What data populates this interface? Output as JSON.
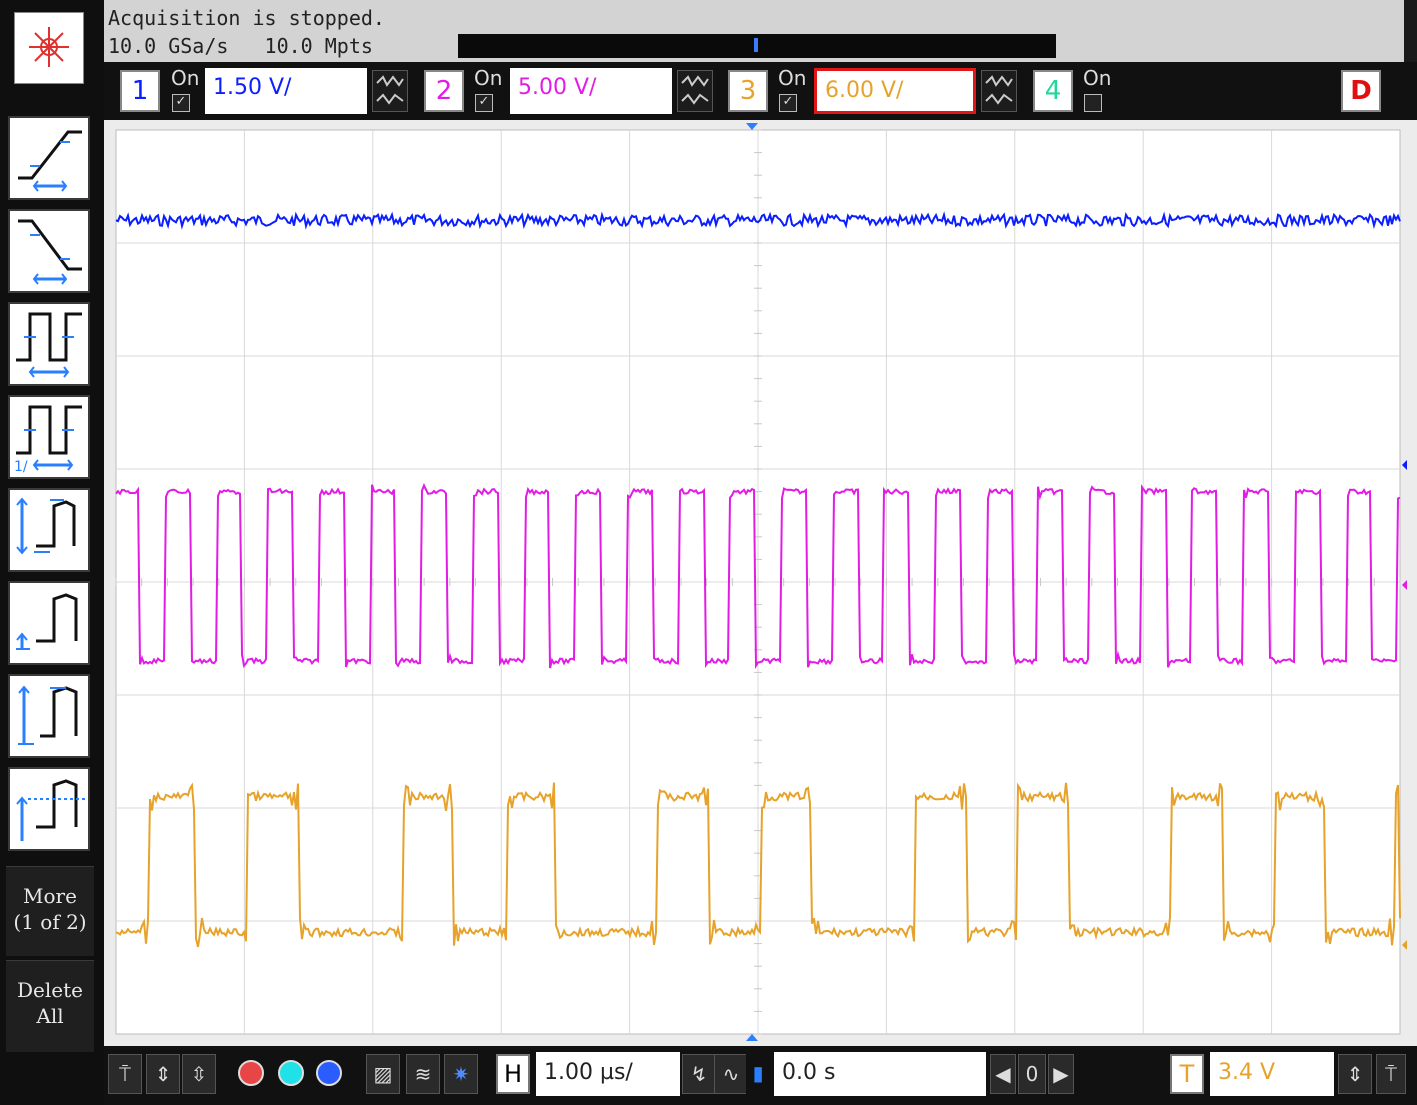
{
  "status": {
    "acquisition": "Acquisition is stopped.",
    "sample_rate": "10.0 GSa/s",
    "memory_depth": "10.0 Mpts"
  },
  "channels": [
    {
      "number": "1",
      "on_label": "On",
      "enabled": true,
      "scale": "1.50 V/",
      "color": "#0a1eff"
    },
    {
      "number": "2",
      "on_label": "On",
      "enabled": true,
      "scale": "5.00 V/",
      "color": "#e21ce6"
    },
    {
      "number": "3",
      "on_label": "On",
      "enabled": true,
      "scale": "6.00 V/",
      "color": "#e6a22a",
      "selected": true,
      "selected_color": "#e11616"
    },
    {
      "number": "4",
      "on_label": "On",
      "enabled": false,
      "color": "#22d79a"
    }
  ],
  "digital_label": "D",
  "sidebar": {
    "more_label_1": "More",
    "more_label_2": "(1 of 2)",
    "delete_label_1": "Delete",
    "delete_label_2": "All",
    "icons": [
      "rise-time-icon",
      "fall-time-icon",
      "period-icon",
      "frequency-icon",
      "peak-to-peak-icon",
      "maximum-icon",
      "amplitude-icon",
      "top-icon"
    ]
  },
  "timebase": {
    "horizontal_label": "H",
    "scale": "1.00 µs/",
    "delay": "0.0 s",
    "zoom_value": "0"
  },
  "trigger": {
    "label": "T",
    "level": "3.4 V"
  },
  "grid": {
    "divisions_x": 10,
    "divisions_y": 8
  },
  "chart_data": {
    "type": "line",
    "series": [
      {
        "channel": "1",
        "kind": "dc",
        "level_div": 0.8,
        "noise_div": 0.05,
        "color": "#0a1eff"
      },
      {
        "channel": "2",
        "kind": "square",
        "period_div": 0.4,
        "duty": 0.5,
        "high_div": 3.2,
        "low_div": 4.7,
        "color": "#e21ce6"
      },
      {
        "channel": "3",
        "kind": "pwm",
        "high_div": 5.9,
        "low_div": 7.1,
        "color": "#e6a22a"
      }
    ]
  }
}
